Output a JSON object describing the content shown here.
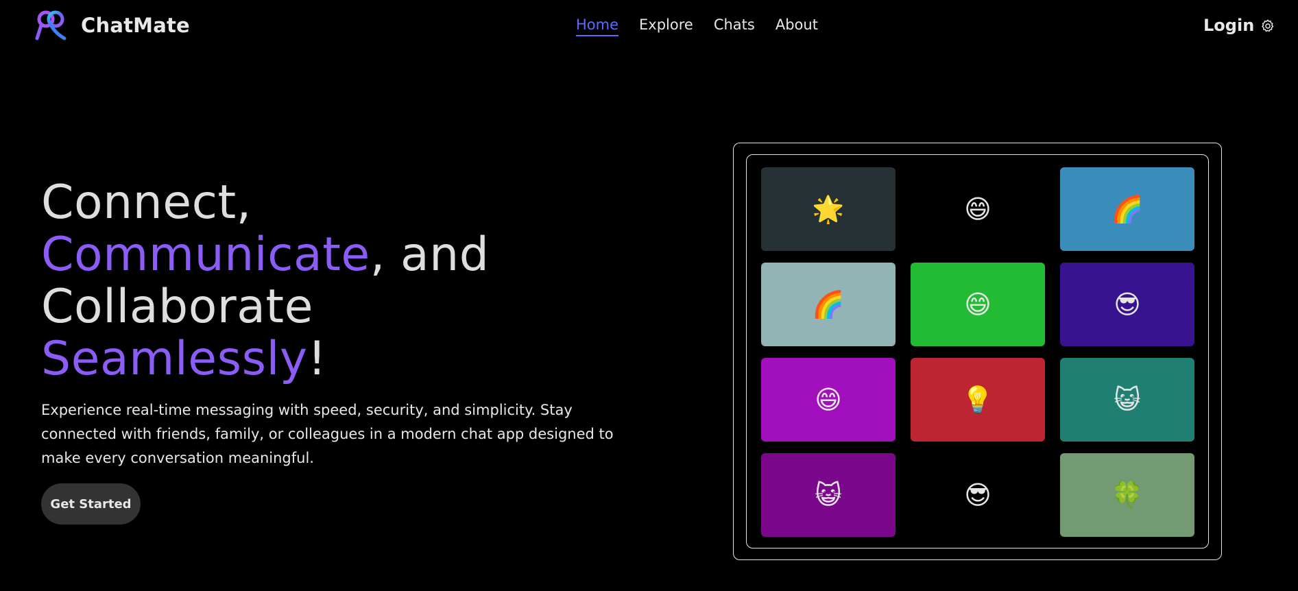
{
  "header": {
    "brand": "ChatMate",
    "nav": [
      "Home",
      "Explore",
      "Chats",
      "About"
    ],
    "active_nav": "Home",
    "login_label": "Login",
    "settings_icon": "gear-icon",
    "logo_colors": {
      "primary": "#a855f7",
      "secondary": "#3b82f6",
      "highlight": "#22d3ee"
    }
  },
  "hero": {
    "line1": "Connect,",
    "line2_accent": "Communicate",
    "line2_rest": ", and",
    "line3": "Collaborate",
    "line4_accent": "Seamlessly",
    "line4_rest": "!",
    "subtitle": "Experience real-time messaging with speed, security, and simplicity. Stay connected with friends, family, or colleagues in a modern chat app designed to make every conversation meaningful.",
    "cta_label": "Get Started",
    "accent_color": "#8b5cf6"
  },
  "tiles": [
    {
      "emoji": "🌟",
      "icon": "star-icon",
      "color": "#263135"
    },
    {
      "emoji": "😄",
      "icon": "grinning-face-icon",
      "color": "#000000"
    },
    {
      "emoji": "🌈",
      "icon": "rainbow-icon",
      "color": "#3a8dba"
    },
    {
      "emoji": "🌈",
      "icon": "rainbow-icon",
      "color": "#93b4b5"
    },
    {
      "emoji": "😄",
      "icon": "grinning-face-icon",
      "color": "#22bb33"
    },
    {
      "emoji": "😎",
      "icon": "sunglasses-face-icon",
      "color": "#37138f"
    },
    {
      "emoji": "😄",
      "icon": "grinning-face-icon",
      "color": "#a20fbd"
    },
    {
      "emoji": "💡",
      "icon": "light-bulb-icon",
      "color": "#be2533"
    },
    {
      "emoji": "😺",
      "icon": "cat-face-icon",
      "color": "#1e7f72"
    },
    {
      "emoji": "😺",
      "icon": "cat-face-icon",
      "color": "#7b088b"
    },
    {
      "emoji": "😎",
      "icon": "sunglasses-face-icon",
      "color": "#000000"
    },
    {
      "emoji": "🍀",
      "icon": "clover-icon",
      "color": "#739a72"
    }
  ]
}
